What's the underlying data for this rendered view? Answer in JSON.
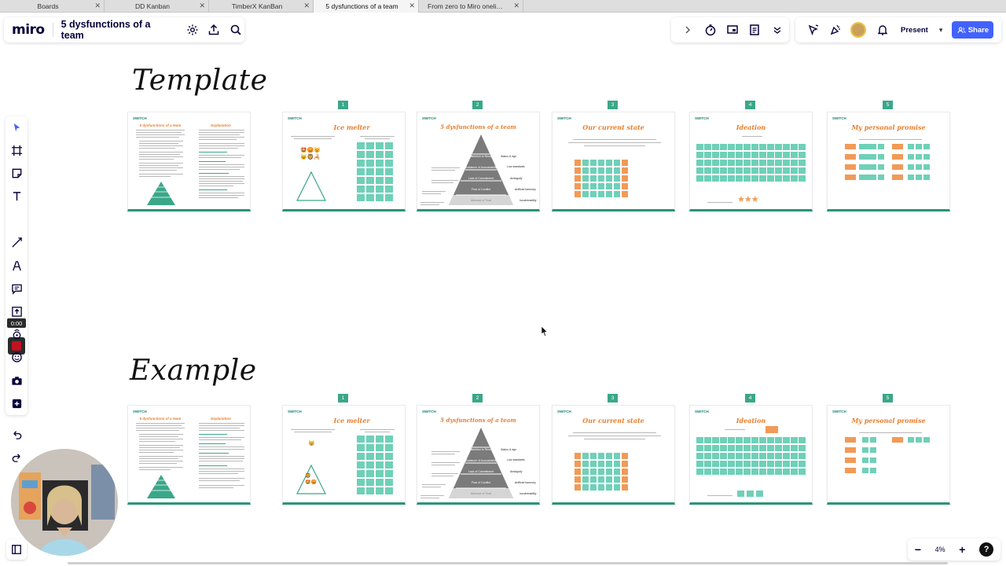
{
  "browser_tabs": [
    {
      "label": "Boards",
      "active": false
    },
    {
      "label": "DD Kanban",
      "active": false
    },
    {
      "label": "TimberX KanBan",
      "active": false
    },
    {
      "label": "5 dysfunctions of a team",
      "active": true
    },
    {
      "label": "From zero to Miro onelinewhiteboard.com",
      "active": false
    }
  ],
  "header": {
    "logo": "miro",
    "board_title": "5 dysfunctions of a team",
    "present_label": "Present",
    "share_label": "Share"
  },
  "icons": {
    "settings": "gear-icon",
    "export": "upload-icon",
    "search": "search-icon",
    "expand": "chevron-right-icon",
    "timer": "timer-icon",
    "screen": "screen-icon",
    "notes": "notes-icon",
    "more": "chevron-down-icon",
    "reactions": "cursor-icon",
    "celebrate": "party-icon",
    "notifications": "bell-icon"
  },
  "toolbar": {
    "timer_display": "0:00"
  },
  "sections": {
    "template_title": "Template",
    "example_title": "Example"
  },
  "frames": {
    "numbers": [
      "1",
      "2",
      "3",
      "4",
      "5"
    ],
    "brand": "SWITCH",
    "titles": [
      "5 dysfunctions of a team",
      "Ice melter",
      "5 dysfunctions of a team",
      "Our current state",
      "Ideation",
      "My personal promise"
    ],
    "pyramid_levels": [
      "Inattention to Results",
      "Avoidance of Accountability",
      "Lack of Commitment",
      "Fear of Conflict",
      "Absence of Trust"
    ],
    "pyramid_labels": [
      "Status & ego",
      "Low standards",
      "Ambiguity",
      "Artificial harmony",
      "Invulnerability"
    ]
  },
  "zoom": {
    "level": "4%",
    "minus": "−",
    "plus": "+",
    "help": "?"
  },
  "colors": {
    "accent_blue": "#4262ff",
    "teal": "#6fd0b8",
    "orange": "#f29a57",
    "frame_rule": "#2b9479"
  }
}
